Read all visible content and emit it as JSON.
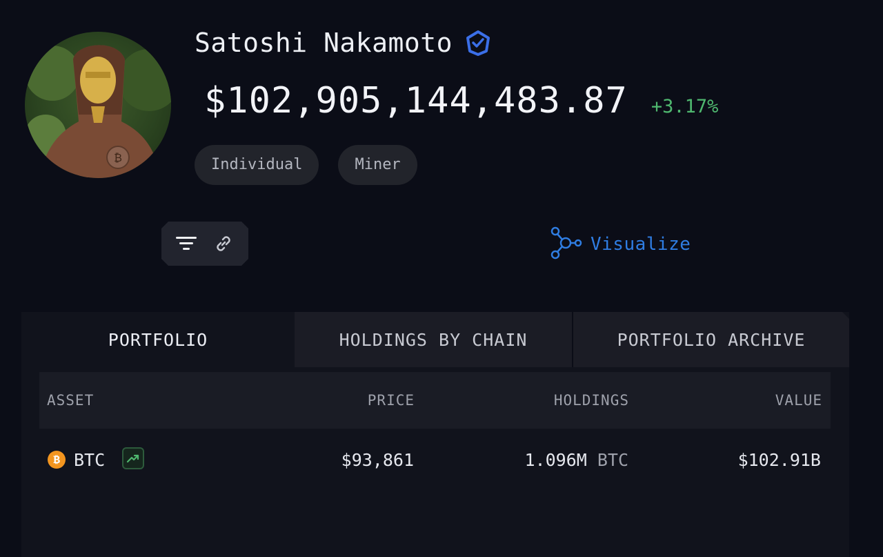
{
  "profile": {
    "name": "Satoshi Nakamoto",
    "balance": "$102,905,144,483.87",
    "change": "+3.17%",
    "tags": [
      "Individual",
      "Miner"
    ],
    "verified_icon": "verified-badge-icon",
    "avatar_icon": "satoshi-statue-avatar"
  },
  "actions": {
    "filter_icon": "filter-icon",
    "link_icon": "link-icon",
    "visualize_label": "Visualize",
    "visualize_icon": "graph-nodes-icon"
  },
  "tabs": [
    {
      "label": "PORTFOLIO",
      "active": true
    },
    {
      "label": "HOLDINGS BY CHAIN",
      "active": false
    },
    {
      "label": "PORTFOLIO ARCHIVE",
      "active": false
    }
  ],
  "table": {
    "columns": [
      "ASSET",
      "PRICE",
      "HOLDINGS",
      "VALUE"
    ],
    "rows": [
      {
        "asset": "BTC",
        "asset_icon": "bitcoin-icon",
        "trend_icon": "trending-up-icon",
        "price": "$93,861",
        "holdings_amount": "1.096M",
        "holdings_unit": "BTC",
        "value": "$102.91B"
      }
    ]
  },
  "colors": {
    "background": "#0b0d17",
    "positive": "#4fb86f",
    "accent_blue": "#2f7de2",
    "bitcoin": "#f3951f"
  }
}
